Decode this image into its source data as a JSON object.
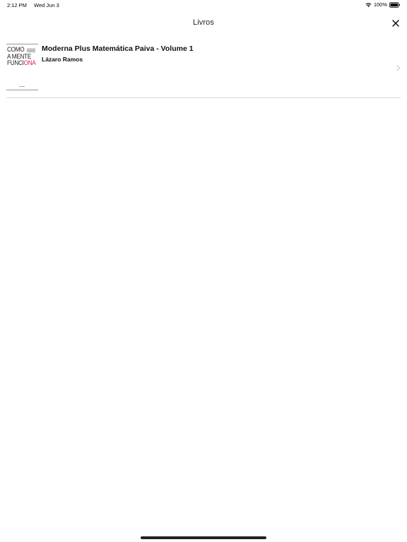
{
  "status_bar": {
    "time": "2:12 PM",
    "date": "Wed Jun 3",
    "battery": "100%",
    "wifi_icon": "wifi-icon",
    "battery_icon": "battery-full-icon"
  },
  "nav": {
    "title": "Livros",
    "close_icon": "close-icon"
  },
  "books": [
    {
      "title": "Moderna Plus Matemática Paiva - Volume 1",
      "author": "Lázaro Ramos",
      "cover": {
        "line1": "COMO",
        "line2": "A MENTE",
        "line3_part1": "FUNCI",
        "line3_highlight": "ONA",
        "highlight_color": "#d81b6e"
      },
      "disclosure_icon": "chevron-right-icon"
    }
  ],
  "colors": {
    "separator": "#d8d8d8",
    "chevron": "#c4c4c4",
    "home_indicator": "#222222"
  }
}
